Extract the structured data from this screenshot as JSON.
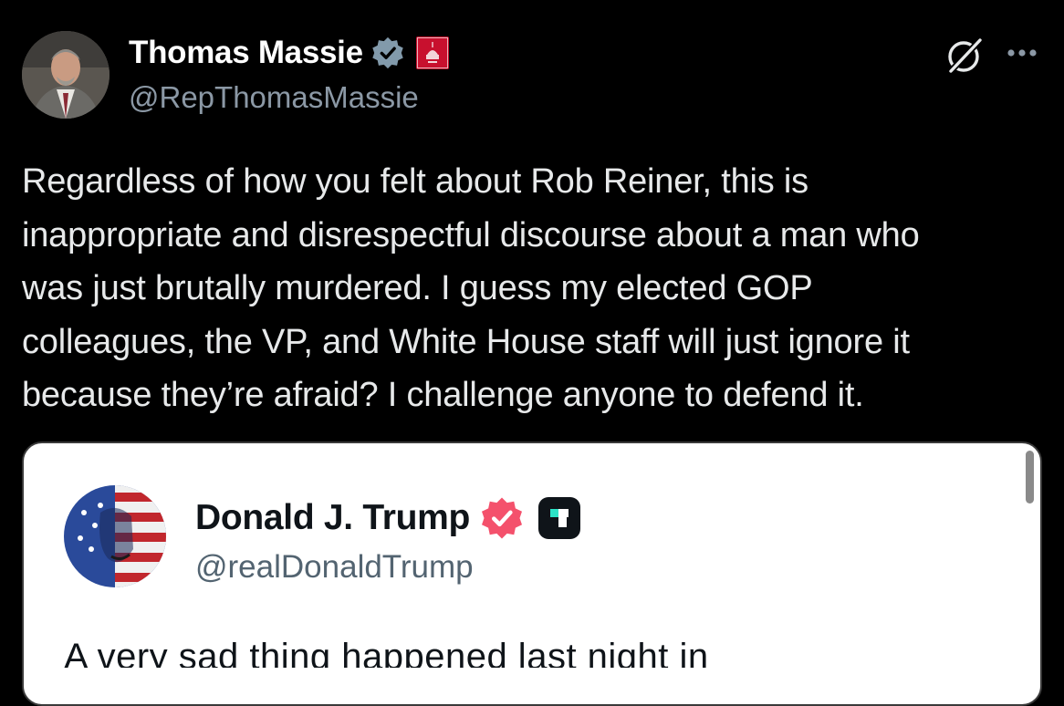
{
  "post": {
    "author_name": "Thomas Massie",
    "author_handle": "@RepThomasMassie",
    "text": "Regardless of how you felt about Rob Reiner, this is\ninappropriate and disrespectful discourse about a man who\nwas just brutally murdered. I guess my elected GOP\ncolleagues, the VP, and White House staff will just ignore it\nbecause they’re afraid? I challenge anyone to defend it."
  },
  "quoted_post": {
    "author_name": "Donald J. Trump",
    "author_handle": "@realDonaldTrump",
    "text_partial": "A very sad thing happened last night in"
  },
  "icons": {
    "verified_badge": "verified-badge-icon",
    "affiliation_badge": "gop-flag-icon",
    "grok": "grok-icon",
    "more": "more-icon",
    "quoted_verified_badge": "verified-badge-icon",
    "quoted_affiliation_badge": "truth-social-icon"
  },
  "colors": {
    "background": "#000000",
    "text_primary": "#e7e9ea",
    "text_secondary": "#8b98a5",
    "verified_blue": "#829aab",
    "gop_red": "#c8102e",
    "quote_bg": "#ffffff",
    "quote_badge_pink": "#f4516c",
    "truth_teal": "#2ce3c7"
  }
}
